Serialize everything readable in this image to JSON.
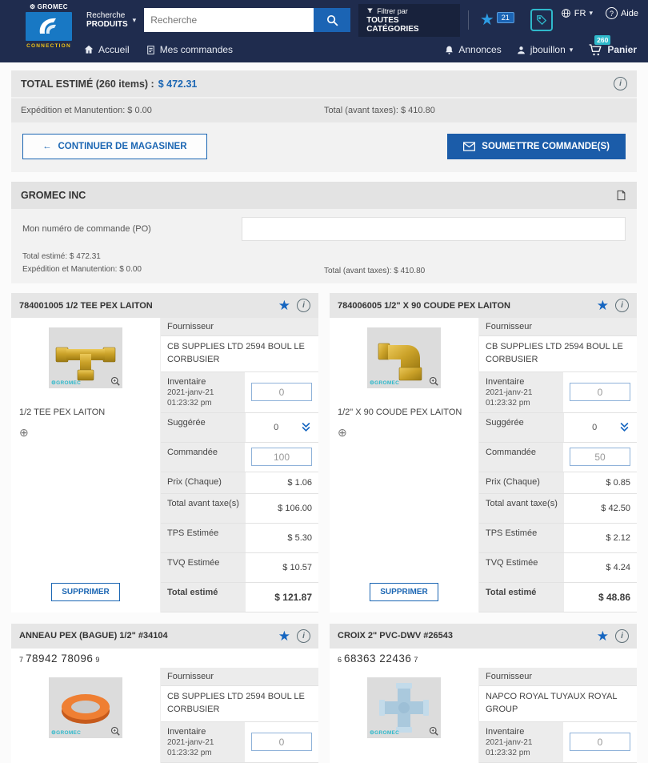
{
  "icons": {
    "gear": "⚙",
    "star": "★",
    "plus_circle": "⊕",
    "back_arrow": "←",
    "chevron_down": "▾",
    "info": "i",
    "watermark": "⚙GROMEC"
  },
  "header": {
    "brand": "GROMEC",
    "brand_sub": "CONNECTION",
    "scope_line1": "Recherche",
    "scope_line2": "PRODUITS",
    "search_placeholder": "Recherche",
    "filter_line1": "Filtrer par",
    "filter_line2": "TOUTES CATÉGORIES",
    "favorites_badge": "21",
    "language": "FR",
    "help": "Aide",
    "nav_home": "Accueil",
    "nav_orders": "Mes commandes",
    "nav_announcements": "Annonces",
    "nav_user": "jbouillon",
    "cart_label": "Panier",
    "cart_badge": "260"
  },
  "summary": {
    "total_label": "TOTAL ESTIMÉ (260 items) :",
    "total_value": "$ 472.31",
    "shipping_line": "Expédition et Manutention: $ 0.00",
    "subtotal_line": "Total (avant taxes): $ 410.80",
    "continue_button": "CONTINUER DE MAGASINER",
    "submit_button": "SOUMETTRE COMMANDE(S)"
  },
  "order_group": {
    "company": "GROMEC INC",
    "po_label": "Mon numéro de commande (PO)",
    "po_value": "",
    "total_line": "Total estimé: $ 472.31",
    "shipping_line": "Expédition et Manutention: $ 0.00",
    "subtotal_line": "Total (avant taxes): $ 410.80"
  },
  "labels": {
    "supplier": "Fournisseur",
    "inventory": "Inventaire",
    "suggested": "Suggérée",
    "ordered": "Commandée",
    "price": "Prix (Chaque)",
    "total_before_tax": "Total avant taxe(s)",
    "tps": "TPS Estimée",
    "tvq": "TVQ Estimée",
    "total_estimated": "Total estimé",
    "delete": "SUPPRIMER"
  },
  "products": [
    {
      "title": "784001005 1/2 TEE PEX LAITON",
      "name": "1/2 TEE PEX LAITON",
      "image": "brass-tee-fitting",
      "supplier": "CB SUPPLIES LTD 2594 BOUL LE CORBUSIER",
      "inventory_date": "2021-janv-21",
      "inventory_time": "01:23:32 pm",
      "inventory_qty": "0",
      "suggested_qty": "0",
      "ordered_qty": "100",
      "price": "$ 1.06",
      "total_before_tax": "$ 106.00",
      "tps": "$ 5.30",
      "tvq": "$ 10.57",
      "total": "$ 121.87"
    },
    {
      "title": "784006005 1/2\" X 90 COUDE PEX LAITON",
      "name": "1/2\" X 90 COUDE PEX LAITON",
      "image": "brass-elbow-fitting",
      "supplier": "CB SUPPLIES LTD 2594 BOUL LE CORBUSIER",
      "inventory_date": "2021-janv-21",
      "inventory_time": "01:23:32 pm",
      "inventory_qty": "0",
      "suggested_qty": "0",
      "ordered_qty": "50",
      "price": "$ 0.85",
      "total_before_tax": "$ 42.50",
      "tps": "$ 2.12",
      "tvq": "$ 4.24",
      "total": "$ 48.86"
    },
    {
      "title": "ANNEAU PEX (BAGUE) 1/2\" #34104",
      "barcode": {
        "prefix": "7",
        "main": "78942 78096",
        "suffix": "9"
      },
      "image": "orange-pex-ring",
      "supplier": "CB SUPPLIES LTD 2594 BOUL LE CORBUSIER",
      "inventory_date": "2021-janv-21",
      "inventory_time": "01:23:32 pm",
      "inventory_qty": "0"
    },
    {
      "title": "CROIX 2\" PVC-DWV #26543",
      "barcode": {
        "prefix": "6",
        "main": "68363 22436",
        "suffix": "7"
      },
      "image": "pvc-cross-fitting",
      "supplier": "NAPCO ROYAL TUYAUX ROYAL GROUP",
      "inventory_date": "2021-janv-21",
      "inventory_time": "01:23:32 pm",
      "inventory_qty": "0"
    }
  ]
}
